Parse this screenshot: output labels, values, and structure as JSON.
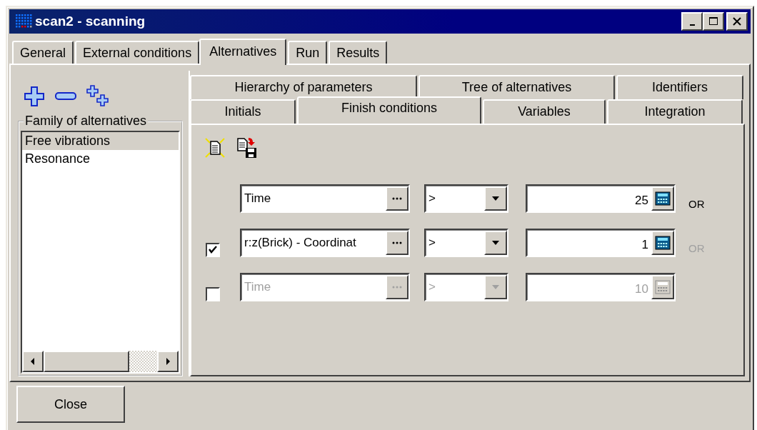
{
  "window": {
    "title": "scan2 - scanning"
  },
  "tabs": [
    {
      "label": "General",
      "selected": false
    },
    {
      "label": "External conditions",
      "selected": false
    },
    {
      "label": "Alternatives",
      "selected": true
    },
    {
      "label": "Run",
      "selected": false
    },
    {
      "label": "Results",
      "selected": false
    }
  ],
  "family": {
    "title": "Family of alternatives",
    "items": [
      {
        "label": "Free vibrations",
        "selected": true
      },
      {
        "label": "Resonance",
        "selected": false
      }
    ]
  },
  "inner_tabs_back": [
    {
      "label": "Hierarchy of parameters",
      "selected": false
    },
    {
      "label": "Tree of alternatives",
      "selected": false
    },
    {
      "label": "Identifiers",
      "selected": false
    }
  ],
  "inner_tabs_front": [
    {
      "label": "Initials",
      "selected": false
    },
    {
      "label": "Finish conditions",
      "selected": true
    },
    {
      "label": "Variables",
      "selected": false
    },
    {
      "label": "Integration",
      "selected": false
    }
  ],
  "conditions": [
    {
      "kind": "fixed",
      "disabled": false,
      "parameter": "Time",
      "operator": ">",
      "value": "25",
      "or_label": {
        "text": "OR",
        "disabled": false
      }
    },
    {
      "kind": "optional",
      "checked": true,
      "disabled": false,
      "parameter": "r:z(Brick) - Coordinat",
      "operator": ">",
      "value": "1",
      "or_label": {
        "text": "OR",
        "disabled": true
      }
    },
    {
      "kind": "optional",
      "checked": false,
      "disabled": true,
      "parameter": "Time",
      "operator": ">",
      "value": "10"
    }
  ],
  "buttons": [
    {
      "label": "Close"
    }
  ]
}
